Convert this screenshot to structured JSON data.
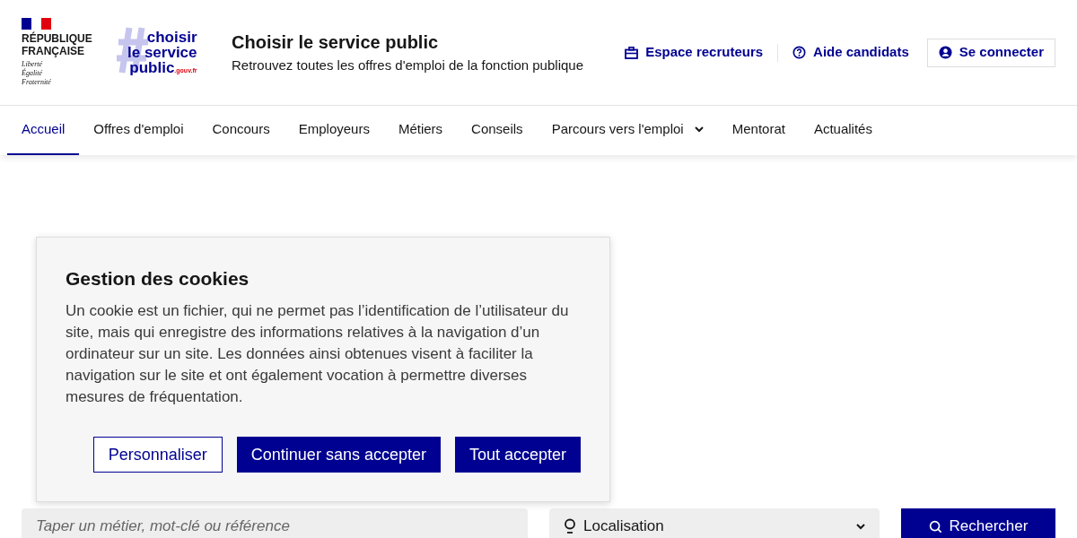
{
  "header": {
    "republic_name": "RÉPUBLIQUE\nFRANÇAISE",
    "motto": [
      "Liberté",
      "Égalité",
      "Fraternité"
    ],
    "site_logo": {
      "lines": [
        "choisir",
        "le service",
        "public"
      ],
      "domain": ".gouv.fr"
    },
    "title": "Choisir le service public",
    "tagline": "Retrouvez toutes les offres d'emploi de la fonction publique",
    "links": [
      {
        "kind": "briefcase",
        "label": "Espace recruteurs"
      },
      {
        "kind": "help",
        "label": "Aide candidats"
      },
      {
        "kind": "account",
        "label": "Se connecter"
      }
    ]
  },
  "nav": [
    {
      "label": "Accueil",
      "selected": true,
      "expandable": false
    },
    {
      "label": "Offres d'emploi",
      "selected": false,
      "expandable": false
    },
    {
      "label": "Concours",
      "selected": false,
      "expandable": false
    },
    {
      "label": "Employeurs",
      "selected": false,
      "expandable": false
    },
    {
      "label": "Métiers",
      "selected": false,
      "expandable": false
    },
    {
      "label": "Conseils",
      "selected": false,
      "expandable": false
    },
    {
      "label": "Parcours vers l'emploi",
      "selected": false,
      "expandable": true
    },
    {
      "label": "Mentorat",
      "selected": false,
      "expandable": false
    },
    {
      "label": "Actualités",
      "selected": false,
      "expandable": false
    }
  ],
  "cookie_dialog": {
    "title": "Gestion des cookies",
    "text": "Un cookie est un fichier, qui ne permet pas l’identification de l’utilisateur du site, mais qui enregistre des informations relatives à la navigation d’un ordinateur sur un site. Les données ainsi obtenues visent à faciliter la navigation sur le site et ont également vocation à permettre diverses mesures de fréquentation.",
    "buttons": [
      {
        "label": "Personnaliser",
        "kind": "secondary"
      },
      {
        "label": "Continuer sans accepter",
        "kind": "primary"
      },
      {
        "label": "Tout accepter",
        "kind": "primary"
      }
    ]
  },
  "search": {
    "placeholder": "Taper un métier, mot-clé ou référence",
    "location": "Localisation",
    "button": "Rechercher"
  }
}
